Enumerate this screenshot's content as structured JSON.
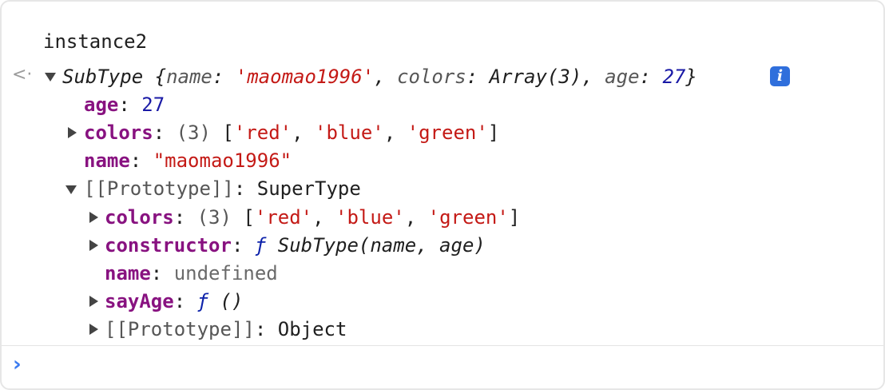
{
  "console": {
    "input_expression": "instance2",
    "result_arrow_icon": "result-arrow-icon",
    "prompt_icon": "prompt-chevron-icon",
    "info_icon": "info-icon",
    "accent_color": "#2f6fdc",
    "summary": {
      "type": "SubType",
      "open_brace": " {",
      "name_key": "name",
      "name_value": "'maomao1996'",
      "colors_key": "colors",
      "colors_value": "Array(3)",
      "age_key": "age",
      "age_value": "27",
      "close_brace": "}"
    },
    "props": {
      "age_key": "age",
      "age_value": "27",
      "colors_key": "colors",
      "colors_count": "(3)",
      "colors_items": [
        "'red'",
        "'blue'",
        "'green'"
      ],
      "name_key": "name",
      "name_value": "\"maomao1996\""
    },
    "prototype": {
      "label": "[[Prototype]]",
      "value": "SuperType",
      "colors_key": "colors",
      "colors_count": "(3)",
      "colors_items": [
        "'red'",
        "'blue'",
        "'green'"
      ],
      "constructor_key": "constructor",
      "constructor_f": "ƒ",
      "constructor_sig": "SubType(name, age)",
      "name_key": "name",
      "name_value": "undefined",
      "sayAge_key": "sayAge",
      "sayAge_f": "ƒ",
      "sayAge_sig": "()",
      "proto_label": "[[Prototype]]",
      "proto_value": "Object"
    }
  }
}
